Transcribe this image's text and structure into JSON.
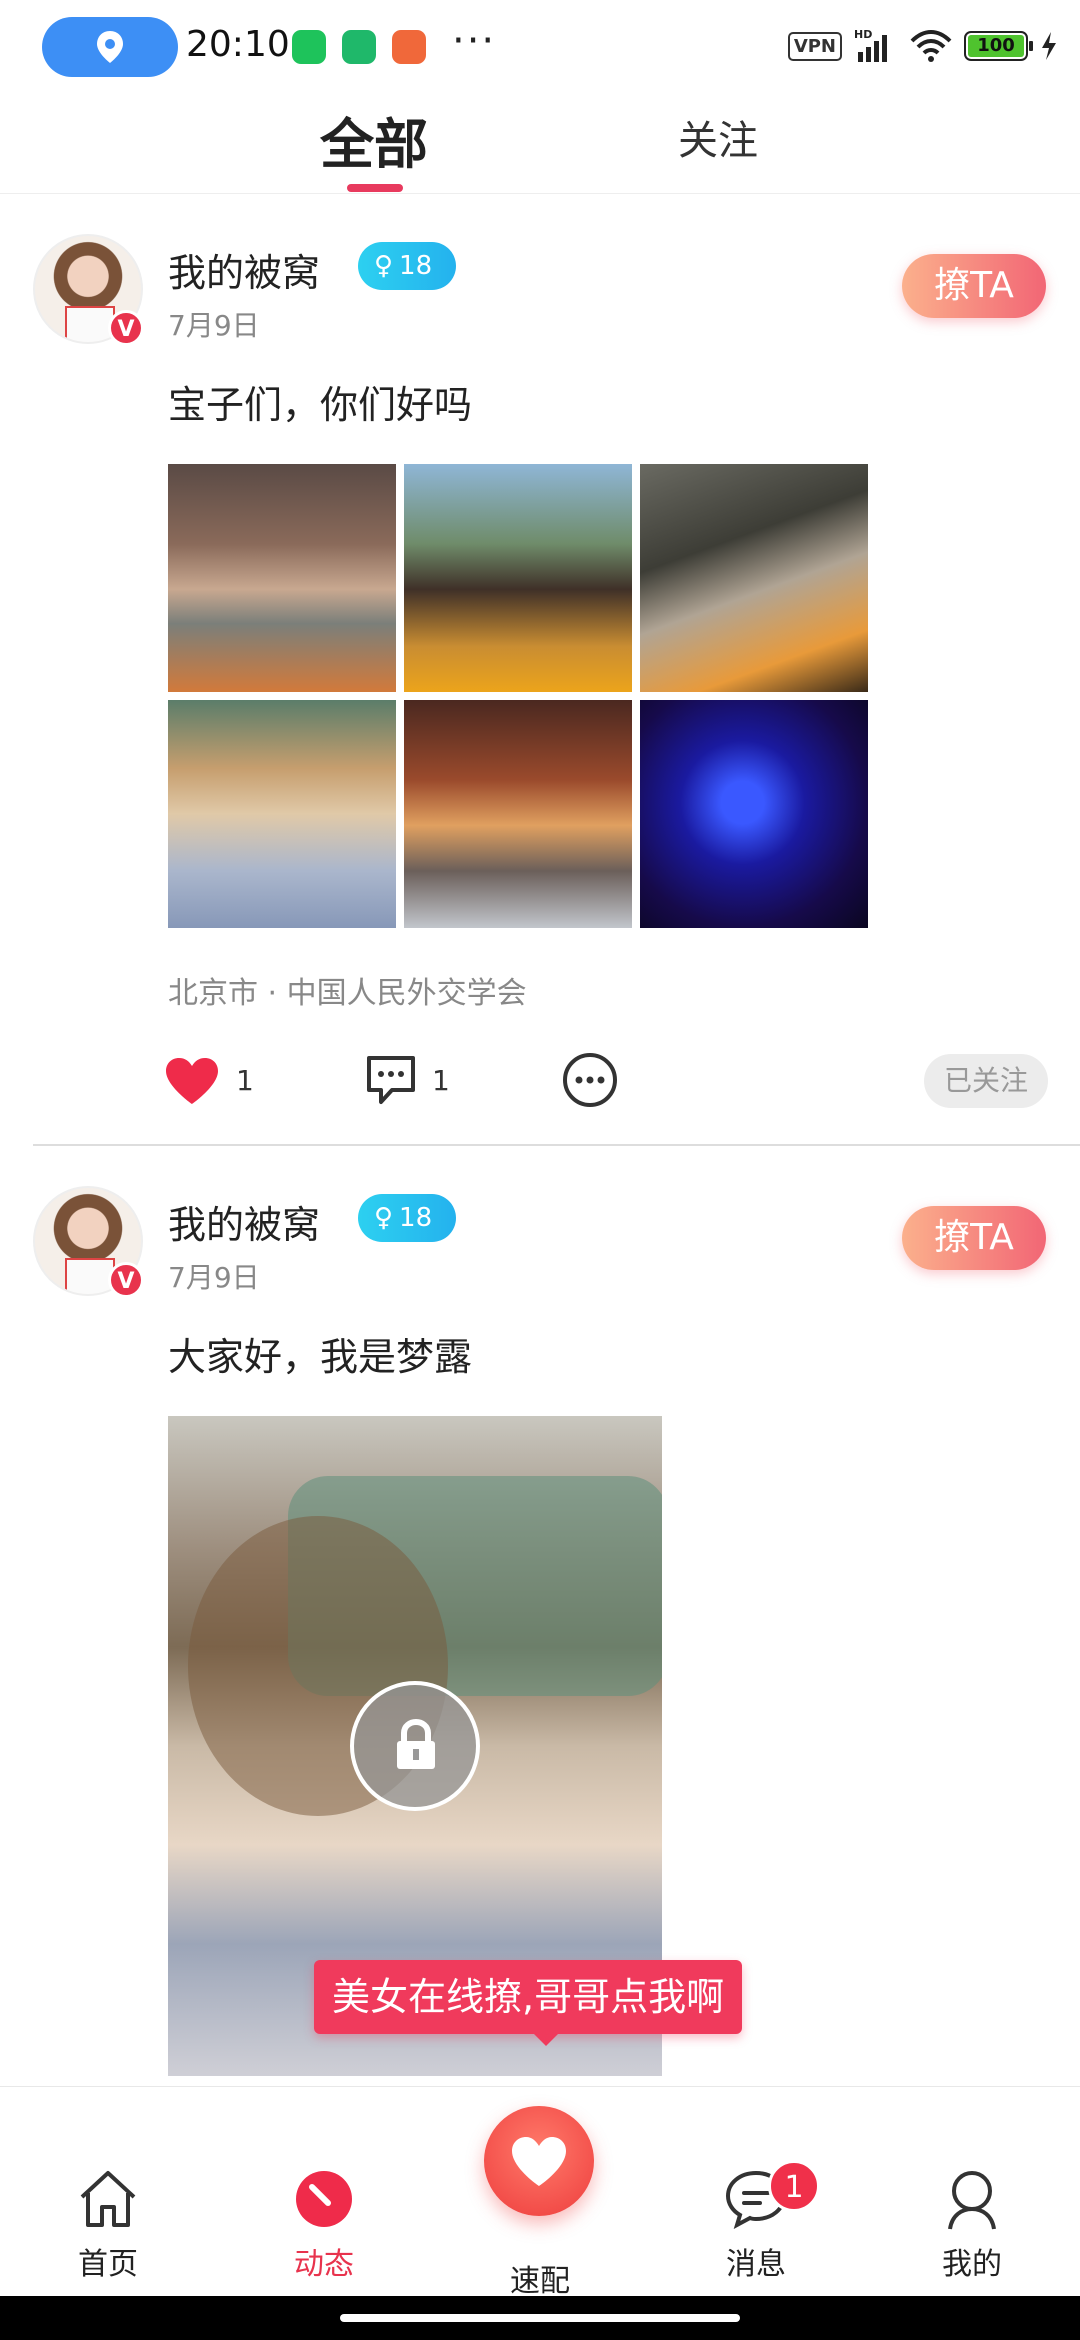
{
  "status_bar": {
    "time": "20:10",
    "vpn": "VPN",
    "network": "HD",
    "battery": "100"
  },
  "tabs": {
    "all": "全部",
    "following": "关注"
  },
  "posts": [
    {
      "username": "我的被窝",
      "age": "18",
      "date": "7月9日",
      "flirt_label": "撩TA",
      "content": "宝子们，你们好吗",
      "location": "北京市 · 中国人民外交学会",
      "likes": "1",
      "comments": "1",
      "follow_status": "已关注"
    },
    {
      "username": "我的被窝",
      "age": "18",
      "date": "7月9日",
      "flirt_label": "撩TA",
      "content": "大家好，我是梦露",
      "promo": "美女在线撩,哥哥点我啊"
    }
  ],
  "bottom_nav": {
    "home": "首页",
    "feed": "动态",
    "match": "速配",
    "messages": "消息",
    "messages_badge": "1",
    "mine": "我的"
  },
  "colors": {
    "accent": "#e8334d",
    "age_badge": "#24b2ee",
    "flirt_gradient_start": "#fbb08c",
    "flirt_gradient_end": "#f26675"
  }
}
